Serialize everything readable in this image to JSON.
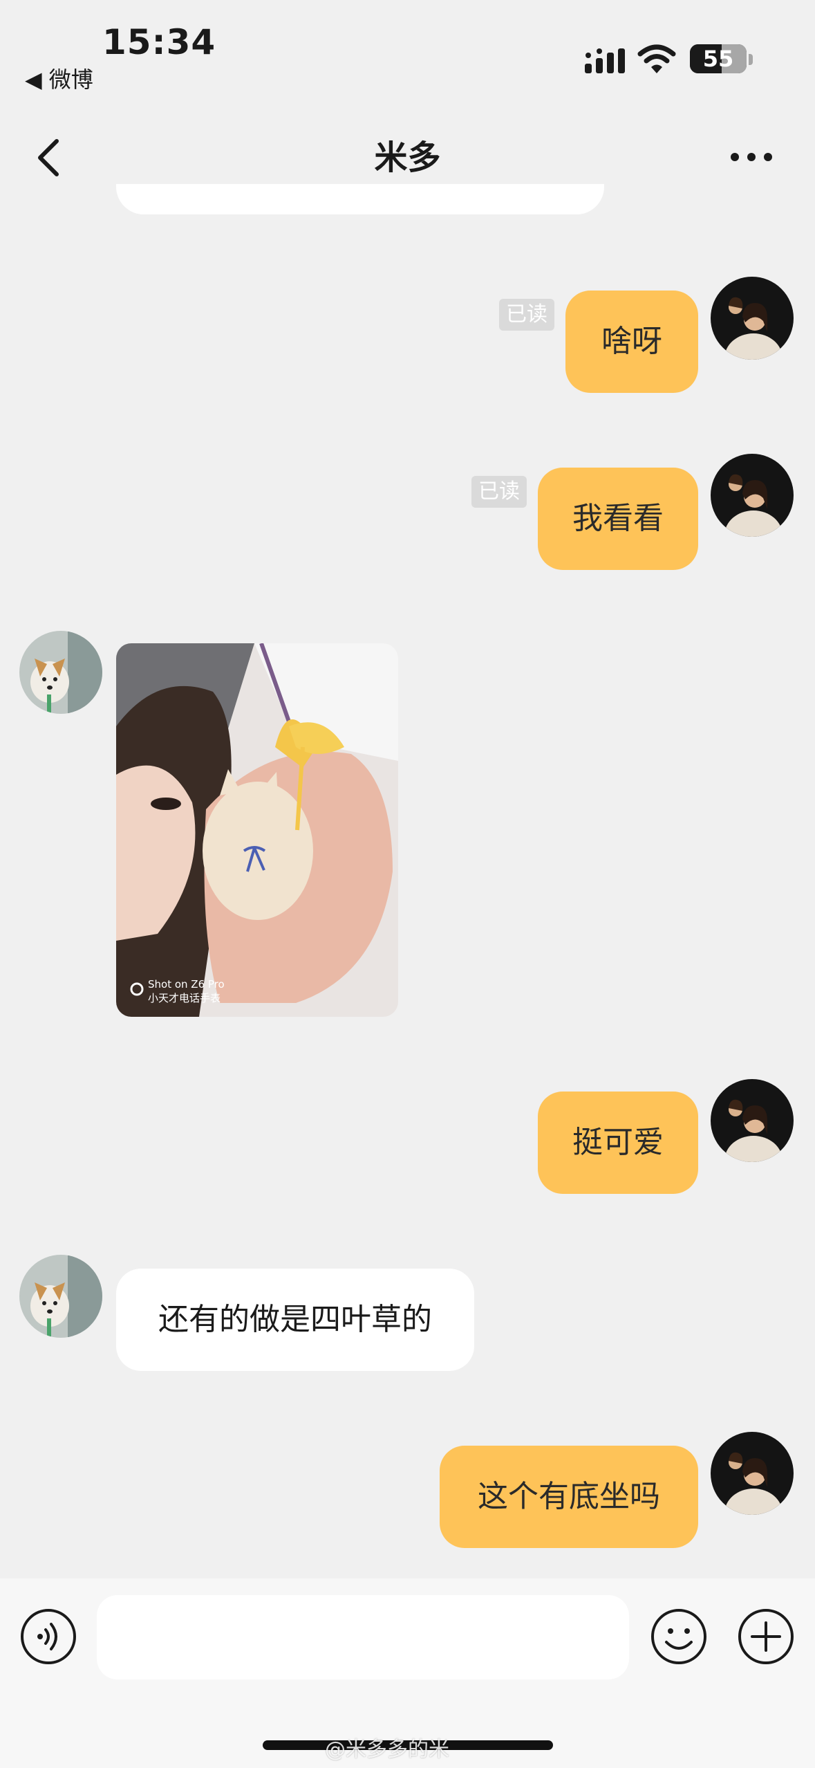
{
  "status_bar": {
    "time": "15:34",
    "back_app": "◀ 微博",
    "battery": "55"
  },
  "nav": {
    "title": "米多"
  },
  "messages": [
    {
      "from": "me",
      "text": "啥呀",
      "read_label": "已读"
    },
    {
      "from": "me",
      "text": "我看看",
      "read_label": "已读"
    },
    {
      "from": "them",
      "type": "image",
      "caption_line1": "Shot on Z6 Pro",
      "caption_line2": "小天才电话手表"
    },
    {
      "from": "me",
      "text": "挺可爱"
    },
    {
      "from": "them",
      "text": "还有的做是四叶草的"
    },
    {
      "from": "me",
      "text": "这个有底坐吗"
    }
  ],
  "input": {
    "placeholder": ""
  },
  "watermark": "@米多多的米",
  "colors": {
    "my_bubble": "#fec358",
    "their_bubble": "#ffffff",
    "background": "#f0f0f0"
  }
}
